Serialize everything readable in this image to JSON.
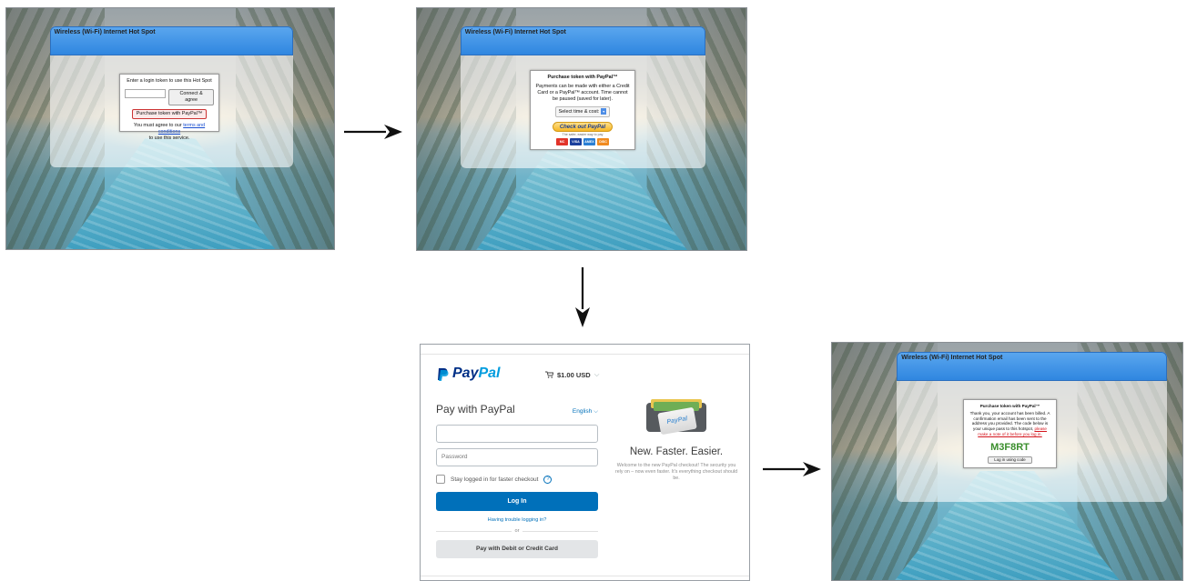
{
  "hotspot": {
    "title": "Wireless (Wi-Fi) Internet Hot Spot"
  },
  "step1": {
    "prompt": "Enter a login token to use this Hot Spot",
    "connect_label": "Connect & agree",
    "purchase_label": "Purchase token with PayPal™",
    "agree_prefix": "You must agree to our",
    "terms_link": "terms and conditions",
    "agree_suffix": "to use this service."
  },
  "step2": {
    "heading": "Purchase token with PayPal™",
    "body": "Payments can be made with either a Credit Card or a PayPal™ account. Time cannot be paused (saved for later).",
    "select_label": "Select time & cost:",
    "checkout_button": "Check out PayPal",
    "safer_text": "The safer, easier way to pay",
    "cards": [
      "MC",
      "VISA",
      "AMEX",
      "DISC"
    ]
  },
  "paypal": {
    "logo_part1": "Pay",
    "logo_part2": "Pal",
    "cart_amount": "$1.00 USD",
    "heading": "Pay with PayPal",
    "language": "English",
    "password_placeholder": "Password",
    "stay_logged_in": "Stay logged in for faster checkout",
    "login_label": "Log In",
    "trouble_link": "Having trouble logging in?",
    "or_text": "or",
    "card_button": "Pay with Debit or Credit Card",
    "wallet_card_text": "PayPal",
    "tagline": "New. Faster. Easier.",
    "description": "Welcome to the new PayPal checkout! The security you rely on – now even faster. It's everything checkout should be."
  },
  "step4": {
    "heading": "Purchase token with PayPal™",
    "body": "Thank you, your account has been billed. A confirmation email has been sent to the address you provided. The code below is your unique pass to this hotspot,",
    "warning": "please make a note of it before you log in.",
    "code": "M3F8RT",
    "login_button": "Log in using code"
  },
  "colors": {
    "hotspot_bar": "#2f86e0",
    "paypal_blue": "#0070ba",
    "paypal_navy": "#003087",
    "code_green": "#3a8e2c"
  }
}
